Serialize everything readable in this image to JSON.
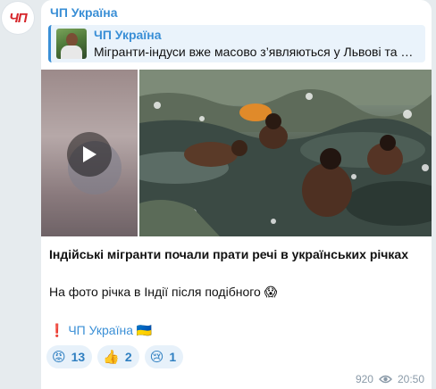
{
  "channel": {
    "avatar_text": "ЧП",
    "name": "ЧП Україна"
  },
  "reply": {
    "title": "ЧП Україна",
    "text": "Мігранти-індуси вже масово з’являються у Львові та …"
  },
  "media": {
    "video_icon": "play-icon",
    "photo_description": ""
  },
  "message": {
    "headline": "Індійські мігранти почали прати речі в українських річках",
    "caption": "На фото річка в Індії після подібного 😱",
    "signature": "❗️ ЧП Україна 🇺🇦"
  },
  "reactions": [
    {
      "emoji": "😡",
      "count": "13"
    },
    {
      "emoji": "👍",
      "count": "2"
    },
    {
      "emoji": "😢",
      "count": "1"
    }
  ],
  "meta": {
    "views": "920",
    "views_icon": "eye-icon",
    "time": "20:50"
  },
  "colors": {
    "accent": "#3a8fd6",
    "background": "#e6ebee",
    "bubble": "#ffffff"
  }
}
